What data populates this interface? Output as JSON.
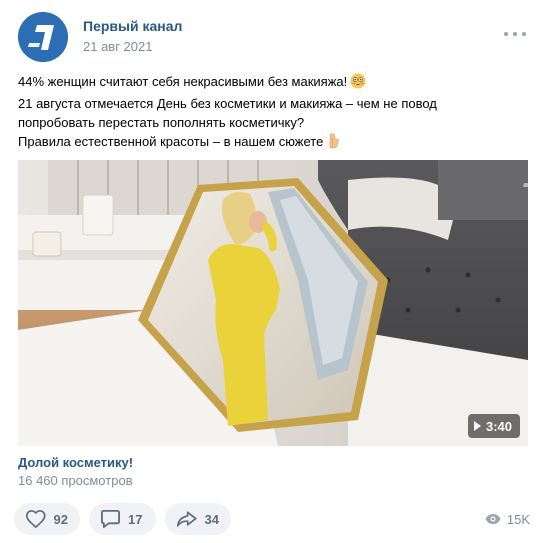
{
  "post": {
    "author": "Первый канал",
    "date": "21 авг 2021",
    "text_lines": [
      "44% женщин считают себя некрасивыми без макияжа!",
      "21 августа отмечается День без косметики и макияжа – чем не повод",
      "попробовать перестать пополнять косметичку?",
      "Правила естественной красоты – в нашем сюжете"
    ]
  },
  "video": {
    "duration": "3:40",
    "title": "Долой косметику!",
    "views": "16 460 просмотров"
  },
  "actions": {
    "likes": "92",
    "comments": "17",
    "shares": "34",
    "views": "15K"
  },
  "colors": {
    "link": "#2a5885",
    "secondary": "#818c99",
    "button_bg": "#f0f2f5",
    "icon": "#5e6c80"
  }
}
